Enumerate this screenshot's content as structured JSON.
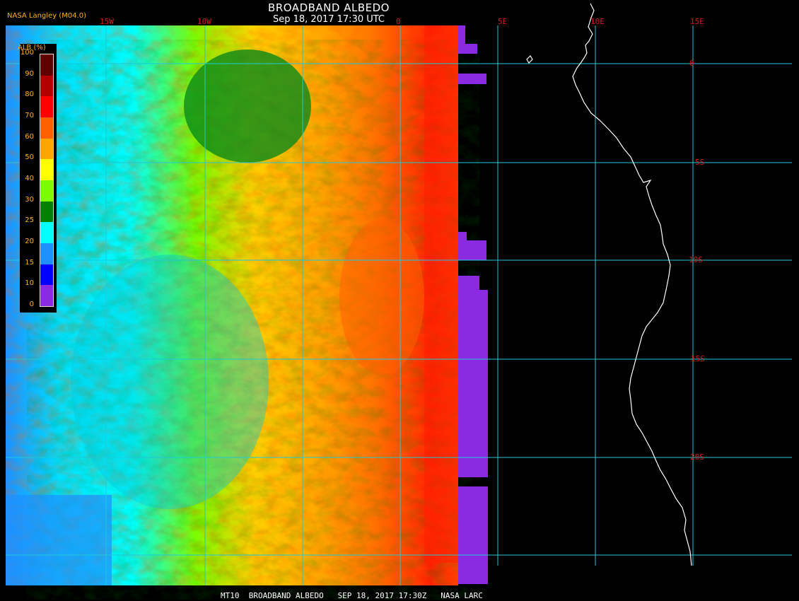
{
  "title": "BROADBAND ALBEDO",
  "subtitle": "Sep 18, 2017 17:30 UTC",
  "credit": "NASA Langley (M04.0)",
  "footer": "MT10  BROADBAND ALBEDO   SEP 18, 2017 17:30Z   NASA LARC",
  "longitude_labels": [
    "15W",
    "10W",
    "0",
    "5E",
    "10E",
    "15E"
  ],
  "latitude_labels": [
    "0",
    "5S",
    "10S",
    "15S",
    "20S"
  ],
  "legend": {
    "title": "ALB (%)",
    "ticks": [
      "0",
      "10",
      "15",
      "20",
      "25",
      "30",
      "40",
      "50",
      "60",
      "70",
      "80",
      "90",
      "100"
    ],
    "colors": [
      "#8a2be2",
      "#0000ff",
      "#1e90ff",
      "#00ffff",
      "#008000",
      "#7cfc00",
      "#ffff00",
      "#ffa500",
      "#ff6000",
      "#ff0000",
      "#b00000",
      "#600000"
    ]
  },
  "colors": {
    "grid": "#20c8d8",
    "coastline": "#ffffff",
    "no_data": "#8a2be2"
  }
}
